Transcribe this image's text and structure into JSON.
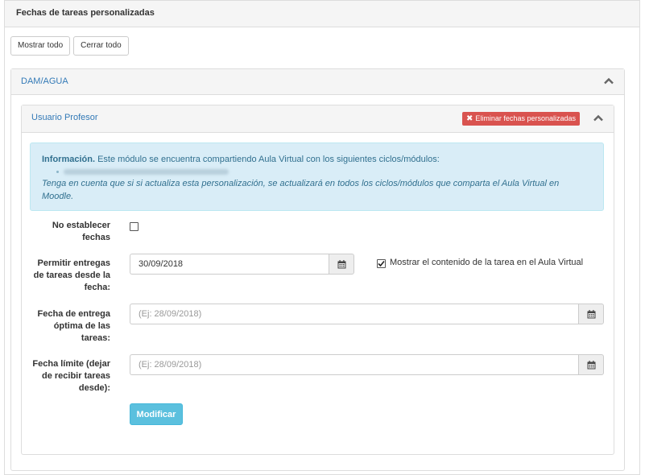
{
  "header": {
    "title": "Fechas de tareas personalizadas"
  },
  "toolbar": {
    "show_all": "Mostrar todo",
    "close_all": "Cerrar todo"
  },
  "group": {
    "title": "DAM/AGUA",
    "user_panel": {
      "title": "Usuario Profesor",
      "delete_badge": "Eliminar fechas personalizadas",
      "info": {
        "label": "Información.",
        "text": "Este módulo se encuentra compartiendo Aula Virtual con los siguientes ciclos/módulos:",
        "note": "Tenga en cuenta que si si actualiza esta personalización, se actualizará en todos los ciclos/módulos que comparta el Aula Virtual en Moodle."
      },
      "form": {
        "no_dates": {
          "label": "No establecer fechas",
          "checked": false
        },
        "allow_from": {
          "label": "Permitir entregas de tareas desde la fecha:",
          "value": "30/09/2018",
          "show_content_label": "Mostrar el contenido de la tarea en el Aula Virtual",
          "show_content_checked": true
        },
        "optimal_due": {
          "label": "Fecha de entrega óptima de las tareas:",
          "value": "",
          "placeholder": "(Ej: 28/09/2018)"
        },
        "deadline": {
          "label": "Fecha límite (dejar de recibir tareas desde):",
          "value": "",
          "placeholder": "(Ej: 28/09/2018)"
        },
        "submit_label": "Modificar"
      }
    }
  },
  "colors": {
    "link": "#337ab7",
    "danger": "#d9534f",
    "info_bg": "#d9edf7",
    "info_text": "#31708f",
    "button_info": "#5bc0de"
  }
}
